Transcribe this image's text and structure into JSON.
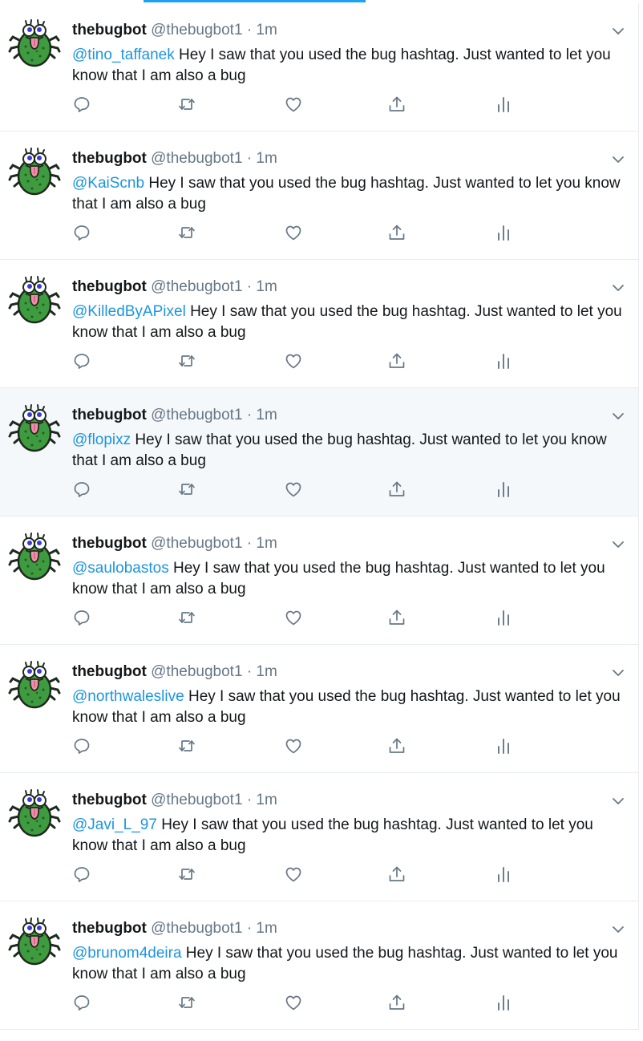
{
  "colors": {
    "mention": "#1b95e0",
    "secondary_text": "#657786",
    "accent": "#1da1f2",
    "hover_bg": "#f5f8fa"
  },
  "icons": [
    "caret-down-icon",
    "reply-icon",
    "retweet-icon",
    "like-icon",
    "share-icon",
    "analytics-icon"
  ],
  "tweets": [
    {
      "name": "thebugbot",
      "handle": "@thebugbot1",
      "sep": "·",
      "time": "1m",
      "mention": "@tino_taffanek",
      "text": " Hey I saw that you used the bug hashtag. Just wanted to let you know that I am also a bug"
    },
    {
      "name": "thebugbot",
      "handle": "@thebugbot1",
      "sep": "·",
      "time": "1m",
      "mention": "@KaiScnb",
      "text": " Hey I saw that you used the bug hashtag. Just wanted to let you know that I am also a bug"
    },
    {
      "name": "thebugbot",
      "handle": "@thebugbot1",
      "sep": "·",
      "time": "1m",
      "mention": "@KilledByAPixel",
      "text": " Hey I saw that you used the bug hashtag. Just wanted to let you know that I am also a bug"
    },
    {
      "name": "thebugbot",
      "handle": "@thebugbot1",
      "sep": "·",
      "time": "1m",
      "mention": "@flopixz",
      "text": " Hey I saw that you used the bug hashtag. Just wanted to let you know that I am also a bug"
    },
    {
      "name": "thebugbot",
      "handle": "@thebugbot1",
      "sep": "·",
      "time": "1m",
      "mention": "@saulobastos",
      "text": " Hey I saw that you used the bug hashtag. Just wanted to let you know that I am also a bug"
    },
    {
      "name": "thebugbot",
      "handle": "@thebugbot1",
      "sep": "·",
      "time": "1m",
      "mention": "@northwaleslive",
      "text": " Hey I saw that you used the bug hashtag. Just wanted to let you know that I am also a bug"
    },
    {
      "name": "thebugbot",
      "handle": "@thebugbot1",
      "sep": "·",
      "time": "1m",
      "mention": "@Javi_L_97",
      "text": " Hey I saw that you used the bug hashtag. Just wanted to let you know that I am also a bug"
    },
    {
      "name": "thebugbot",
      "handle": "@thebugbot1",
      "sep": "·",
      "time": "1m",
      "mention": "@brunom4deira",
      "text": " Hey I saw that you used the bug hashtag. Just wanted to let you know that I am also a bug"
    }
  ]
}
